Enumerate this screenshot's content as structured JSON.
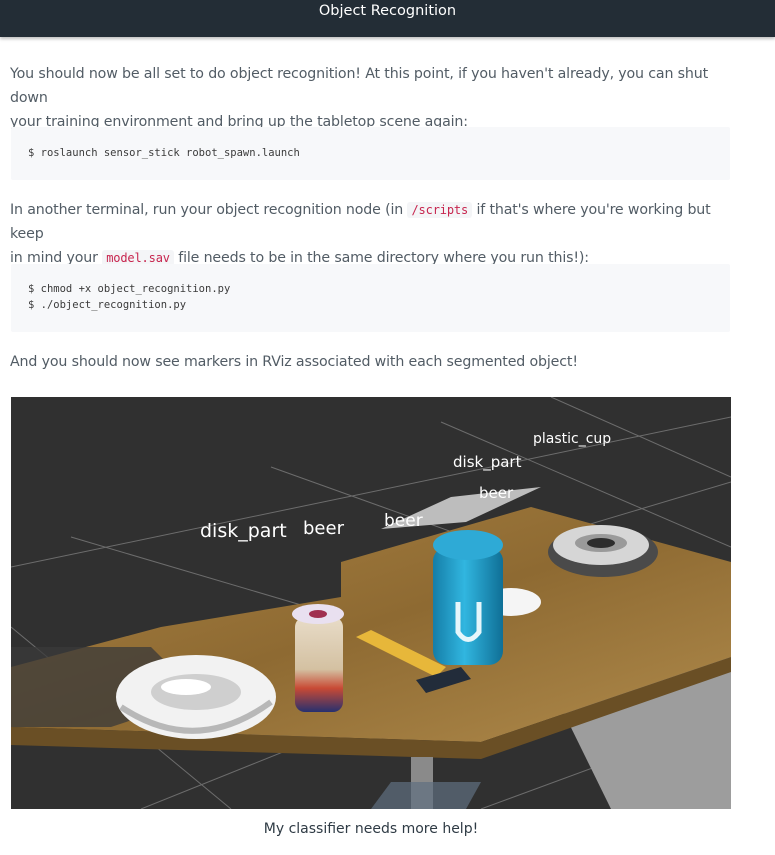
{
  "header": {
    "title": "Object Recognition"
  },
  "intro": {
    "line1": "You should now be all set to do object recognition! At this point, if you haven't already, you can shut down",
    "line2": "your training environment and bring up the tabletop scene again:"
  },
  "code1": {
    "line1": "$ roslaunch sensor_stick robot_spawn.launch"
  },
  "para2": {
    "part1": "In another terminal, run your object recognition node (in ",
    "code_a": "/scripts",
    "part2": " if that's where you're working but keep",
    "part3": "in mind your ",
    "code_b": "model.sav",
    "part4": " file needs to be in the same directory where you run this!):"
  },
  "code2": {
    "line1": "$ chmod +x object_recognition.py",
    "line2": "$ ./object_recognition.py"
  },
  "para3": {
    "text": "And you should now see markers in RViz associated with each segmented object!"
  },
  "scene": {
    "labels": {
      "plastic_cup": "plastic_cup",
      "disk_part_right": "disk_part",
      "beer_right": "beer",
      "disk_part_left": "disk_part",
      "beer_middle": "beer",
      "beer_left": "beer"
    }
  },
  "caption": {
    "text": "My classifier needs more help!"
  },
  "colors": {
    "topbar": "#232d36",
    "text": "#525c65",
    "inline_code": "#c7254e",
    "code_background": "#f7f8fa",
    "scene_background": "#303030"
  }
}
